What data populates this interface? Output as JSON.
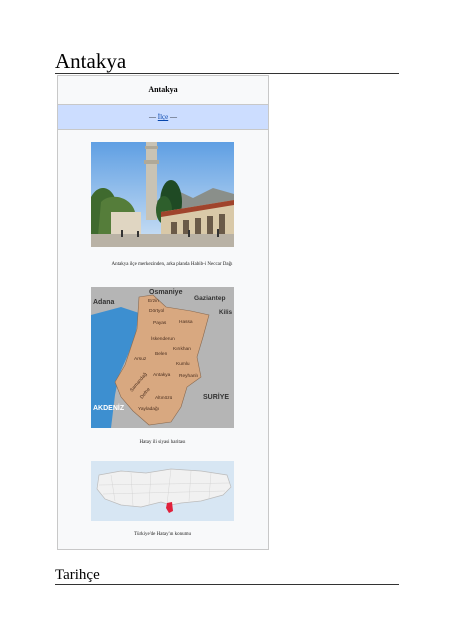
{
  "heading": "Antakya",
  "infobox": {
    "title": "Antakya",
    "subtitle_prefix": "— ",
    "subtitle_link": "İlçe",
    "subtitle_suffix": " —",
    "photo_caption": "Antakya ilçe merkezinden, arka planda Habib-i Neccar Dağı",
    "political_map": {
      "caption": "Hatay ili siyasi haritası",
      "labels": {
        "osmaniye": "Osmaniye",
        "gaziantep": "Gaziantep",
        "adana": "Adana",
        "erzin": "Erzin",
        "kilis": "Kilis",
        "dortyol": "Dörtyol",
        "hassa": "Hassa",
        "payas": "Payas",
        "iskenderun": "İskenderun",
        "kirikhan": "Kırıkhan",
        "arsuz": "Arsuz",
        "belen": "Belen",
        "kumlu": "Kumlu",
        "antakya": "Antakya",
        "reyhanli": "Reyhanlı",
        "samandag": "Samandağ",
        "defne": "Defne",
        "altinozu": "Altınözü",
        "yayladagi": "Yayladağı",
        "akdeniz": "AKDENİZ",
        "suriye": "SURİYE"
      }
    },
    "location_map_caption": "Türkiye'de Hatay'ın konumu"
  },
  "section_heading": "Tarihçe",
  "colors": {
    "infobox_subheader_bg": "#ccddff",
    "link": "#0645ad",
    "district_fill": "#d8a880",
    "sea": "#3d8fd0",
    "neighbor_land": "#b5b5b5",
    "highlight": "#e0203a"
  }
}
